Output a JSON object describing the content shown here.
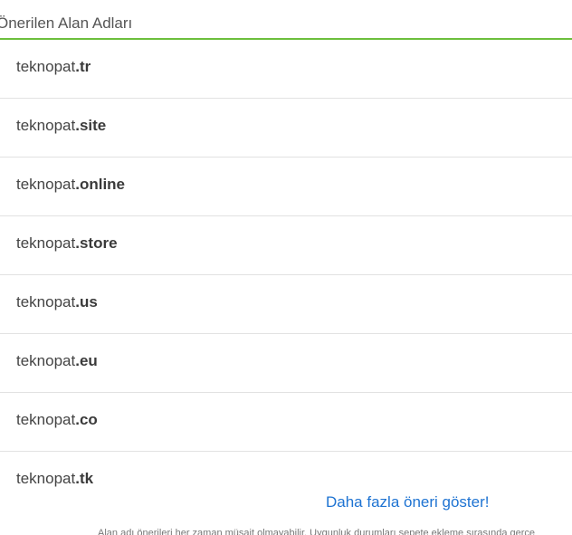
{
  "section": {
    "title": "Önerilen Alan Adları"
  },
  "domains": [
    {
      "name": "teknopat",
      "tld": ".tr"
    },
    {
      "name": "teknopat",
      "tld": ".site"
    },
    {
      "name": "teknopat",
      "tld": ".online"
    },
    {
      "name": "teknopat",
      "tld": ".store"
    },
    {
      "name": "teknopat",
      "tld": ".us"
    },
    {
      "name": "teknopat",
      "tld": ".eu"
    },
    {
      "name": "teknopat",
      "tld": ".co"
    },
    {
      "name": "teknopat",
      "tld": ".tk"
    }
  ],
  "more_link": "Daha fazla öneri göster!",
  "disclaimer": "Alan adı önerileri her zaman müsait olmayabilir. Uygunluk durumları sepete ekleme sırasında gerçe",
  "colors": {
    "accent_rule": "#6cbf3d",
    "link": "#1e73d2"
  }
}
